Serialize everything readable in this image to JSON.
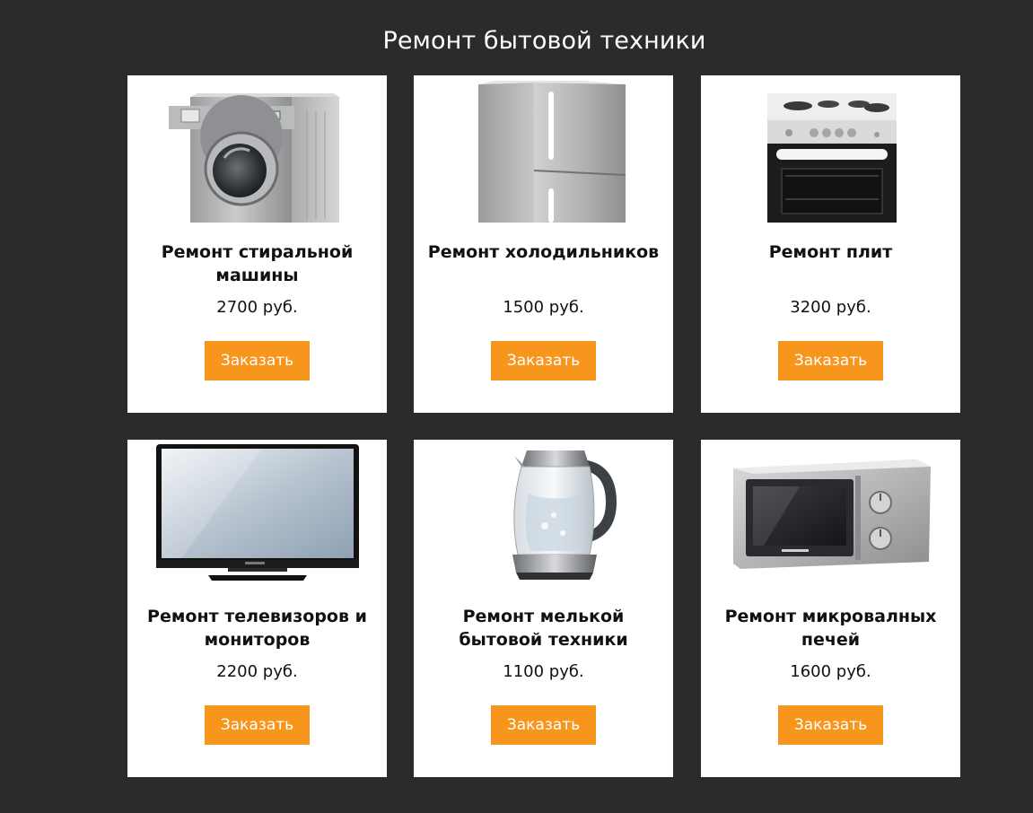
{
  "page": {
    "title": "Ремонт бытовой техники",
    "background_color": "#2b2b2b",
    "card_color": "#ffffff",
    "accent_color": "#f7951d"
  },
  "cards": [
    {
      "name": "Ремонт стиральной машины",
      "price": "2700 руб.",
      "button_label": "Заказать",
      "image": "washing-machine-image"
    },
    {
      "name": "Ремонт холодильников",
      "price": "1500 руб.",
      "button_label": "Заказать",
      "image": "refrigerator-image"
    },
    {
      "name": "Ремонт плит",
      "price": "3200 руб.",
      "button_label": "Заказать",
      "image": "electric-stove-image"
    },
    {
      "name": "Ремонт телевизоров и мониторов",
      "price": "2200 руб.",
      "button_label": "Заказать",
      "image": "television-image"
    },
    {
      "name": "Ремонт мелькой бытовой техники",
      "price": "1100 руб.",
      "button_label": "Заказать",
      "image": "kettle-image"
    },
    {
      "name": "Ремонт микровалных печей",
      "price": "1600 руб.",
      "button_label": "Заказать",
      "image": "microwave-image"
    }
  ]
}
